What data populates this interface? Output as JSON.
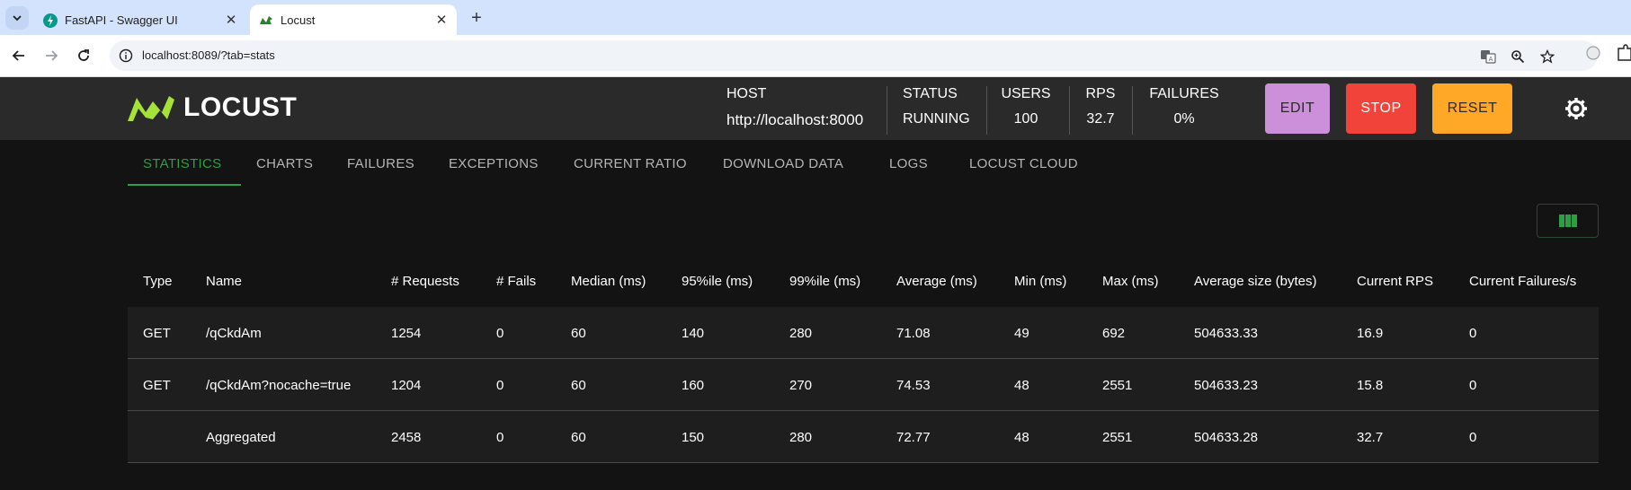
{
  "browser": {
    "tabs": [
      {
        "title": "FastAPI - Swagger UI",
        "favicon": "fastapi-icon",
        "active": false
      },
      {
        "title": "Locust",
        "favicon": "locust-icon",
        "active": true
      }
    ],
    "url": "localhost:8089/?tab=stats"
  },
  "header": {
    "logo_text": "LOCUST",
    "stats": {
      "host": {
        "label": "HOST",
        "value": "http://localhost:8000"
      },
      "status": {
        "label": "STATUS",
        "value": "RUNNING"
      },
      "users": {
        "label": "USERS",
        "value": "100"
      },
      "rps": {
        "label": "RPS",
        "value": "32.7"
      },
      "failures": {
        "label": "FAILURES",
        "value": "0%"
      }
    },
    "buttons": {
      "edit": "EDIT",
      "stop": "STOP",
      "reset": "RESET"
    }
  },
  "nav": {
    "tabs": [
      "STATISTICS",
      "CHARTS",
      "FAILURES",
      "EXCEPTIONS",
      "CURRENT RATIO",
      "DOWNLOAD DATA",
      "LOGS",
      "LOCUST CLOUD"
    ],
    "active": "STATISTICS"
  },
  "table": {
    "columns": [
      "Type",
      "Name",
      "# Requests",
      "# Fails",
      "Median (ms)",
      "95%ile (ms)",
      "99%ile (ms)",
      "Average (ms)",
      "Min (ms)",
      "Max (ms)",
      "Average size (bytes)",
      "Current RPS",
      "Current Failures/s"
    ],
    "rows": [
      [
        "GET",
        "/qCkdAm",
        "1254",
        "0",
        "60",
        "140",
        "280",
        "71.08",
        "49",
        "692",
        "504633.33",
        "16.9",
        "0"
      ],
      [
        "GET",
        "/qCkdAm?nocache=true",
        "1204",
        "0",
        "60",
        "160",
        "270",
        "74.53",
        "48",
        "2551",
        "504633.23",
        "15.8",
        "0"
      ],
      [
        "",
        "Aggregated",
        "2458",
        "0",
        "60",
        "150",
        "280",
        "72.77",
        "48",
        "2551",
        "504633.28",
        "32.7",
        "0"
      ]
    ]
  },
  "colors": {
    "accent_green": "#2e9e46",
    "edit": "#cc8fd9",
    "stop": "#f2433a",
    "reset": "#ffa726",
    "logo_green": "#a4e23a"
  }
}
